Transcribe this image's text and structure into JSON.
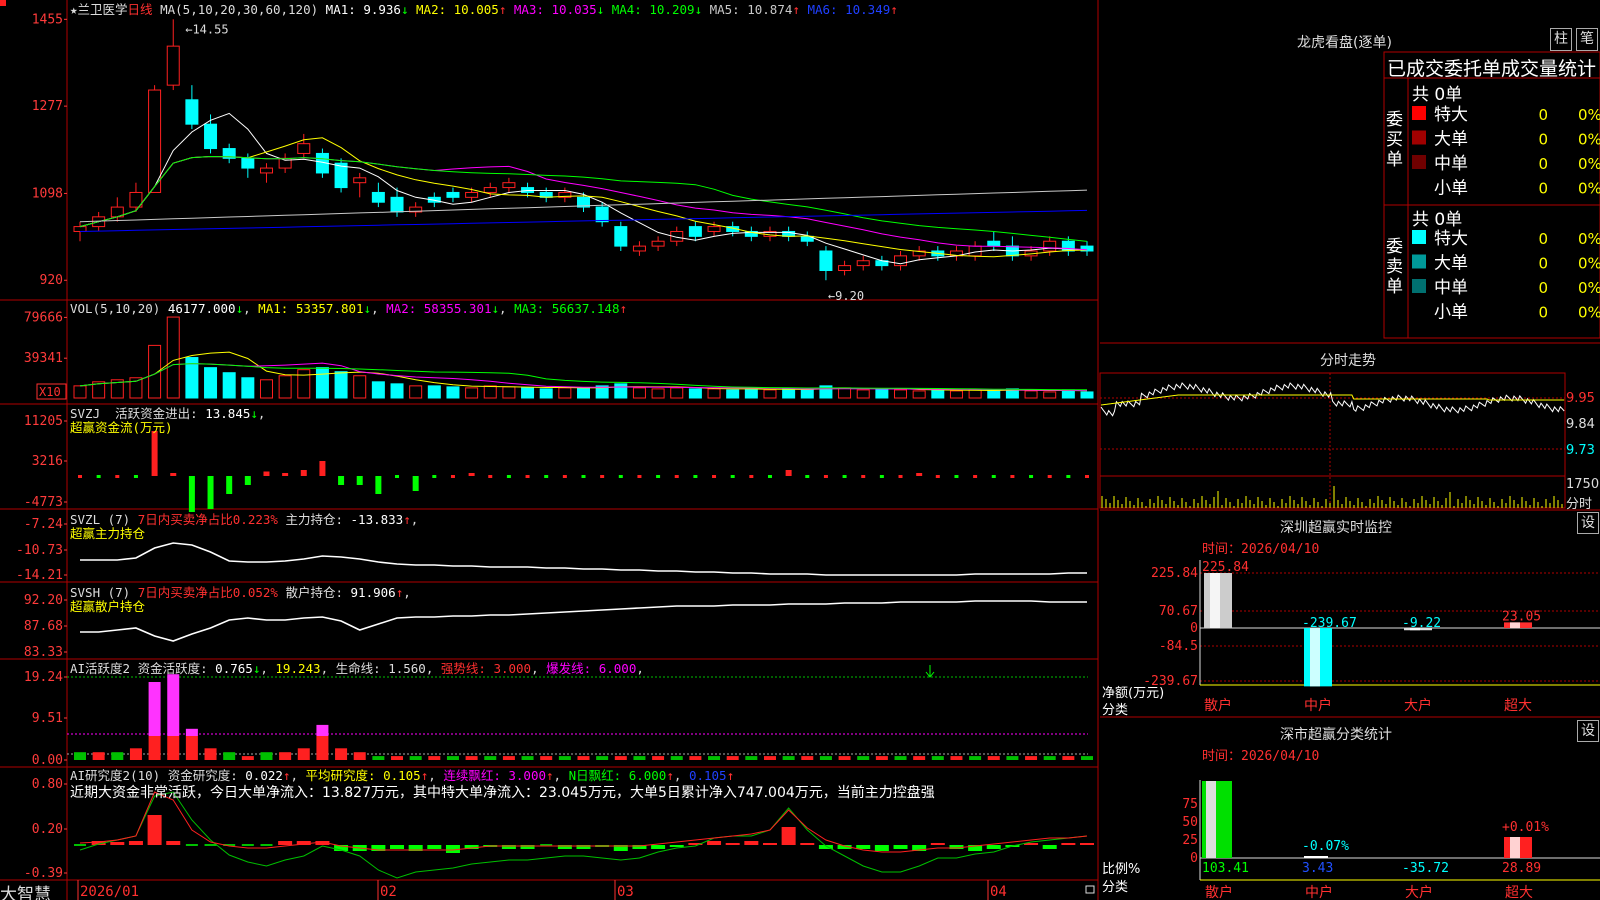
{
  "stock": {
    "name": "兰卫医学",
    "period": "日线",
    "star": "★"
  },
  "colors": {
    "up": "#ff2020",
    "down": "#00ffff",
    "ma1": "#ffffff",
    "ma2": "#ffff00",
    "ma3": "#ff00ff",
    "ma4": "#00ff00",
    "ma5": "#c8c8c8",
    "ma6": "#0000ff",
    "frame": "#b00000",
    "grid": "#800000"
  },
  "price_pane": {
    "label": "MA(5,10,20,30,60,120)",
    "mas": [
      {
        "name": "MA1:",
        "value": "9.936",
        "arrow": "↓"
      },
      {
        "name": "MA2:",
        "value": "10.005",
        "arrow": "↑"
      },
      {
        "name": "MA3:",
        "value": "10.035",
        "arrow": "↓"
      },
      {
        "name": "MA4:",
        "value": "10.209",
        "arrow": "↓"
      },
      {
        "name": "MA5:",
        "value": "10.874",
        "arrow": "↑"
      },
      {
        "name": "MA6:",
        "value": "10.349",
        "arrow": "↑"
      }
    ],
    "ticks": [
      "1455",
      "1277",
      "1098",
      "920"
    ],
    "high_label": "14.55",
    "low_label": "9.20"
  },
  "vol_pane": {
    "label": "VOL(5,10,20)",
    "value": "46177.000",
    "value_arrow": "↓",
    "mas": [
      {
        "name": "MA1:",
        "value": "53357.801",
        "arrow": "↓"
      },
      {
        "name": "MA2:",
        "value": "58355.301",
        "arrow": "↓"
      },
      {
        "name": "MA3:",
        "value": "56637.148",
        "arrow": "↑"
      }
    ],
    "ticks": [
      "79666",
      "39341"
    ],
    "unit": "X10"
  },
  "svzj_pane": {
    "label": "SVZJ",
    "item": "活跃资金进出:",
    "value": "13.845",
    "arrow": "↓",
    "title": "超赢资金流(万元)",
    "ticks": [
      "11205",
      "3216",
      "-4773"
    ]
  },
  "svzl_pane": {
    "label": "SVZL (7)",
    "note": "7日内买卖净占比0.223%",
    "item": "主力持仓:",
    "value": "-13.833",
    "arrow": "↑",
    "title": "超赢主力持仓",
    "ticks": [
      "-7.24",
      "-10.73",
      "-14.21"
    ]
  },
  "svsh_pane": {
    "label": "SVSH (7)",
    "note": "7日内买卖净占比0.052%",
    "item": "散户持仓:",
    "value": "91.906",
    "arrow": "↑",
    "title": "超赢散户持仓",
    "ticks": [
      "92.20",
      "87.68",
      "83.33"
    ]
  },
  "ai1_pane": {
    "label": "AI活跃度2",
    "item": "资金活跃度:",
    "value": "0.765",
    "arrow": "↓",
    "v2": "19.243",
    "life": "生命线:",
    "life_val": "1.560",
    "strong": "强势线:",
    "strong_val": "3.000",
    "burst": "爆发线:",
    "burst_val": "6.000",
    "ticks": [
      "19.24",
      "9.51",
      "0.00"
    ]
  },
  "ai2_pane": {
    "label": "AI研究度2(10)",
    "item": "资金研究度:",
    "value": "0.022",
    "arrow": "↑",
    "avg": "平均研究度:",
    "avg_val": "0.105",
    "avg_arrow": "↑",
    "cont": "连续飘红:",
    "cont_val": "3.000",
    "cont_arrow": "↑",
    "n": "N日飘红:",
    "n_val": "6.000",
    "n_arrow": "↑",
    "last": "0.105",
    "last_arrow": "↑",
    "comment": "近期大资金非常活跃，今日大单净流入：13.827万元，其中特大单净流入：23.045万元，大单5日累计净入747.004万元，当前主力控盘强",
    "ticks": [
      "0.80",
      "0.20",
      "-0.39"
    ]
  },
  "xaxis": {
    "labels": [
      "2026/01",
      "02",
      "03",
      "04"
    ],
    "brand": "大智慧"
  },
  "right": {
    "dragon_title": "龙虎看盘(逐单)",
    "btn_zhu": "柱",
    "btn_bi": "笔",
    "order_header": "已成交委托单成交量统计",
    "buy": {
      "side": "委买单",
      "total": "共 0单",
      "rows": [
        {
          "name": "特大",
          "qty": "0",
          "pct": "0%",
          "color": "#ff0000"
        },
        {
          "name": "大单",
          "qty": "0",
          "pct": "0%",
          "color": "#a00000"
        },
        {
          "name": "中单",
          "qty": "0",
          "pct": "0%",
          "color": "#700000"
        },
        {
          "name": "小单",
          "qty": "0",
          "pct": "0%",
          "color": ""
        }
      ]
    },
    "sell": {
      "side": "委卖单",
      "total": "共 0单",
      "rows": [
        {
          "name": "特大",
          "qty": "0",
          "pct": "0%",
          "color": "#00ffff"
        },
        {
          "name": "大单",
          "qty": "0",
          "pct": "0%",
          "color": "#009a9a"
        },
        {
          "name": "中单",
          "qty": "0",
          "pct": "0%",
          "color": "#007070"
        },
        {
          "name": "小单",
          "qty": "0",
          "pct": "0%",
          "color": ""
        }
      ]
    },
    "intraday": {
      "title": "分时走势",
      "ticks": [
        "9.95",
        "9.84",
        "9.73"
      ],
      "vol_tick": "1750",
      "vol_label": "分时"
    },
    "monitor": {
      "title": "深圳超赢实时监控",
      "btn": "设",
      "time": "时间：2026/04/10",
      "ticks": [
        "225.84",
        "70.67",
        "0",
        "-84.5",
        "-239.67"
      ],
      "ylabel": "净额(万元)",
      "xlabel": "分类",
      "cats": [
        "散户",
        "中户",
        "大户",
        "超大"
      ],
      "values": [
        225.84,
        -239.67,
        -9.22,
        23.05
      ],
      "value_labels": [
        "225.84",
        "-239.67",
        "-9.22",
        "23.05"
      ]
    },
    "classify": {
      "title": "深市超赢分类统计",
      "btn": "设",
      "time": "时间：2026/04/10",
      "ticks": [
        "75",
        "50",
        "25",
        "0"
      ],
      "ylabel": "比例%",
      "xlabel": "分类",
      "cats": [
        "散户",
        "中户",
        "大户",
        "超大"
      ],
      "bottom_vals": [
        "103.41",
        "3.43",
        "-35.72",
        "28.89"
      ],
      "annotations": [
        "-0.07%",
        "+0.01%"
      ]
    }
  },
  "chart_data": {
    "type": "candlestick",
    "title": "兰卫医学 日线",
    "x_labels": [
      "2026/01",
      "02",
      "03",
      "04"
    ],
    "ylim": [
      9.0,
      14.7
    ],
    "ohlc": [
      [
        10.2,
        10.4,
        10.0,
        10.3
      ],
      [
        10.3,
        10.6,
        10.2,
        10.5
      ],
      [
        10.5,
        10.9,
        10.4,
        10.7
      ],
      [
        10.7,
        11.2,
        10.6,
        11.0
      ],
      [
        11.0,
        13.2,
        11.0,
        13.1
      ],
      [
        13.2,
        14.55,
        13.1,
        14.0
      ],
      [
        12.9,
        13.2,
        12.3,
        12.4
      ],
      [
        12.4,
        12.6,
        11.8,
        11.9
      ],
      [
        11.9,
        12.0,
        11.6,
        11.7
      ],
      [
        11.7,
        11.8,
        11.3,
        11.5
      ],
      [
        11.4,
        11.6,
        11.2,
        11.5
      ],
      [
        11.5,
        11.8,
        11.4,
        11.7
      ],
      [
        11.8,
        12.2,
        11.7,
        12.0
      ],
      [
        11.8,
        11.9,
        11.3,
        11.4
      ],
      [
        11.6,
        11.7,
        11.0,
        11.1
      ],
      [
        11.2,
        11.4,
        10.9,
        11.3
      ],
      [
        11.0,
        11.2,
        10.7,
        10.8
      ],
      [
        10.9,
        11.1,
        10.5,
        10.6
      ],
      [
        10.6,
        10.8,
        10.5,
        10.7
      ],
      [
        10.9,
        11.0,
        10.7,
        10.8
      ],
      [
        11.0,
        11.1,
        10.8,
        10.9
      ],
      [
        10.9,
        11.1,
        10.8,
        11.0
      ],
      [
        11.0,
        11.2,
        10.9,
        11.1
      ],
      [
        11.1,
        11.3,
        11.0,
        11.2
      ],
      [
        11.1,
        11.2,
        10.9,
        11.0
      ],
      [
        11.0,
        11.1,
        10.8,
        10.9
      ],
      [
        10.9,
        11.1,
        10.8,
        11.0
      ],
      [
        10.9,
        11.0,
        10.6,
        10.7
      ],
      [
        10.7,
        10.8,
        10.3,
        10.4
      ],
      [
        10.3,
        10.4,
        9.8,
        9.9
      ],
      [
        9.8,
        10.0,
        9.7,
        9.9
      ],
      [
        9.9,
        10.1,
        9.8,
        10.0
      ],
      [
        10.0,
        10.3,
        9.9,
        10.2
      ],
      [
        10.3,
        10.4,
        10.0,
        10.1
      ],
      [
        10.2,
        10.4,
        10.1,
        10.3
      ],
      [
        10.3,
        10.4,
        10.1,
        10.2
      ],
      [
        10.2,
        10.3,
        10.0,
        10.1
      ],
      [
        10.1,
        10.3,
        10.0,
        10.2
      ],
      [
        10.2,
        10.3,
        10.0,
        10.1
      ],
      [
        10.1,
        10.2,
        9.9,
        10.0
      ],
      [
        9.8,
        9.9,
        9.2,
        9.4
      ],
      [
        9.4,
        9.6,
        9.3,
        9.5
      ],
      [
        9.5,
        9.7,
        9.4,
        9.6
      ],
      [
        9.6,
        9.7,
        9.4,
        9.5
      ],
      [
        9.5,
        9.8,
        9.4,
        9.7
      ],
      [
        9.7,
        9.9,
        9.6,
        9.8
      ],
      [
        9.8,
        9.9,
        9.6,
        9.7
      ],
      [
        9.7,
        9.9,
        9.6,
        9.8
      ],
      [
        9.7,
        10.0,
        9.6,
        9.9
      ],
      [
        10.0,
        10.2,
        9.8,
        9.9
      ],
      [
        9.9,
        10.1,
        9.6,
        9.7
      ],
      [
        9.7,
        9.9,
        9.6,
        9.8
      ],
      [
        9.8,
        10.1,
        9.7,
        10.0
      ],
      [
        10.0,
        10.1,
        9.7,
        9.8
      ],
      [
        9.9,
        10.0,
        9.7,
        9.8
      ]
    ],
    "volume": [
      12,
      16,
      18,
      20,
      52,
      80,
      40,
      30,
      25,
      20,
      18,
      22,
      28,
      30,
      26,
      22,
      16,
      14,
      12,
      12,
      11,
      10,
      12,
      11,
      10,
      9,
      10,
      10,
      12,
      14,
      10,
      9,
      10,
      9,
      9,
      8,
      9,
      8,
      9,
      8,
      12,
      10,
      8,
      9,
      8,
      7,
      8,
      7,
      8,
      7,
      9,
      7,
      6,
      8,
      6
    ]
  }
}
